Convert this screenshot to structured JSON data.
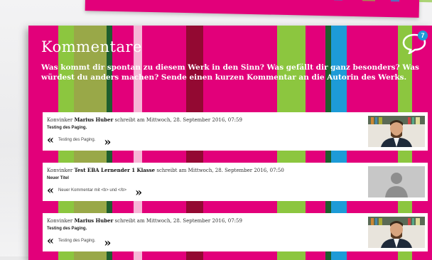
{
  "page": {
    "title": "Kommentare",
    "intro": "Was kommt dir spontan zu diesem Werk in den Sinn? Was gefällt dir ganz besonders? Was würdest du anders machen? Sende einen kurzen Kommentar an die Autorin des Werks.",
    "comment_count": "7"
  },
  "colors": {
    "magenta": "#e2007a",
    "green": "#8cc63f",
    "blue": "#1d9bd7",
    "dark_red": "#8b0a2a",
    "dark_green": "#1e5e2e"
  },
  "comments": [
    {
      "prefix": "Konvinker",
      "author": "Marius Huber",
      "suffix": "schreibt am Mittwoch, 28. September 2016, 07:59",
      "title": "Testing des Paging.",
      "text": "Testing des Paging.",
      "avatar": "photo-avatar"
    },
    {
      "prefix": "Konvinker",
      "author": "Test EBA Lernender 1 Klasse",
      "suffix": "schreibt am Mittwoch, 28. September 2016, 07:50",
      "title": "Neuer Titel",
      "text": "Neuer Kommentar mit <b> und </b>",
      "avatar": "placeholder-avatar"
    },
    {
      "prefix": "Konvinker",
      "author": "Marius Huber",
      "suffix": "schreibt am Mittwoch, 28. September 2016, 07:59",
      "title": "Testing des Paging.",
      "text": "Testing des Paging.",
      "avatar": "photo-avatar"
    }
  ],
  "icons": {
    "comments": "speech-bubble-icon",
    "open_quote": "quote-open-icon",
    "close_quote": "quote-close-icon"
  }
}
